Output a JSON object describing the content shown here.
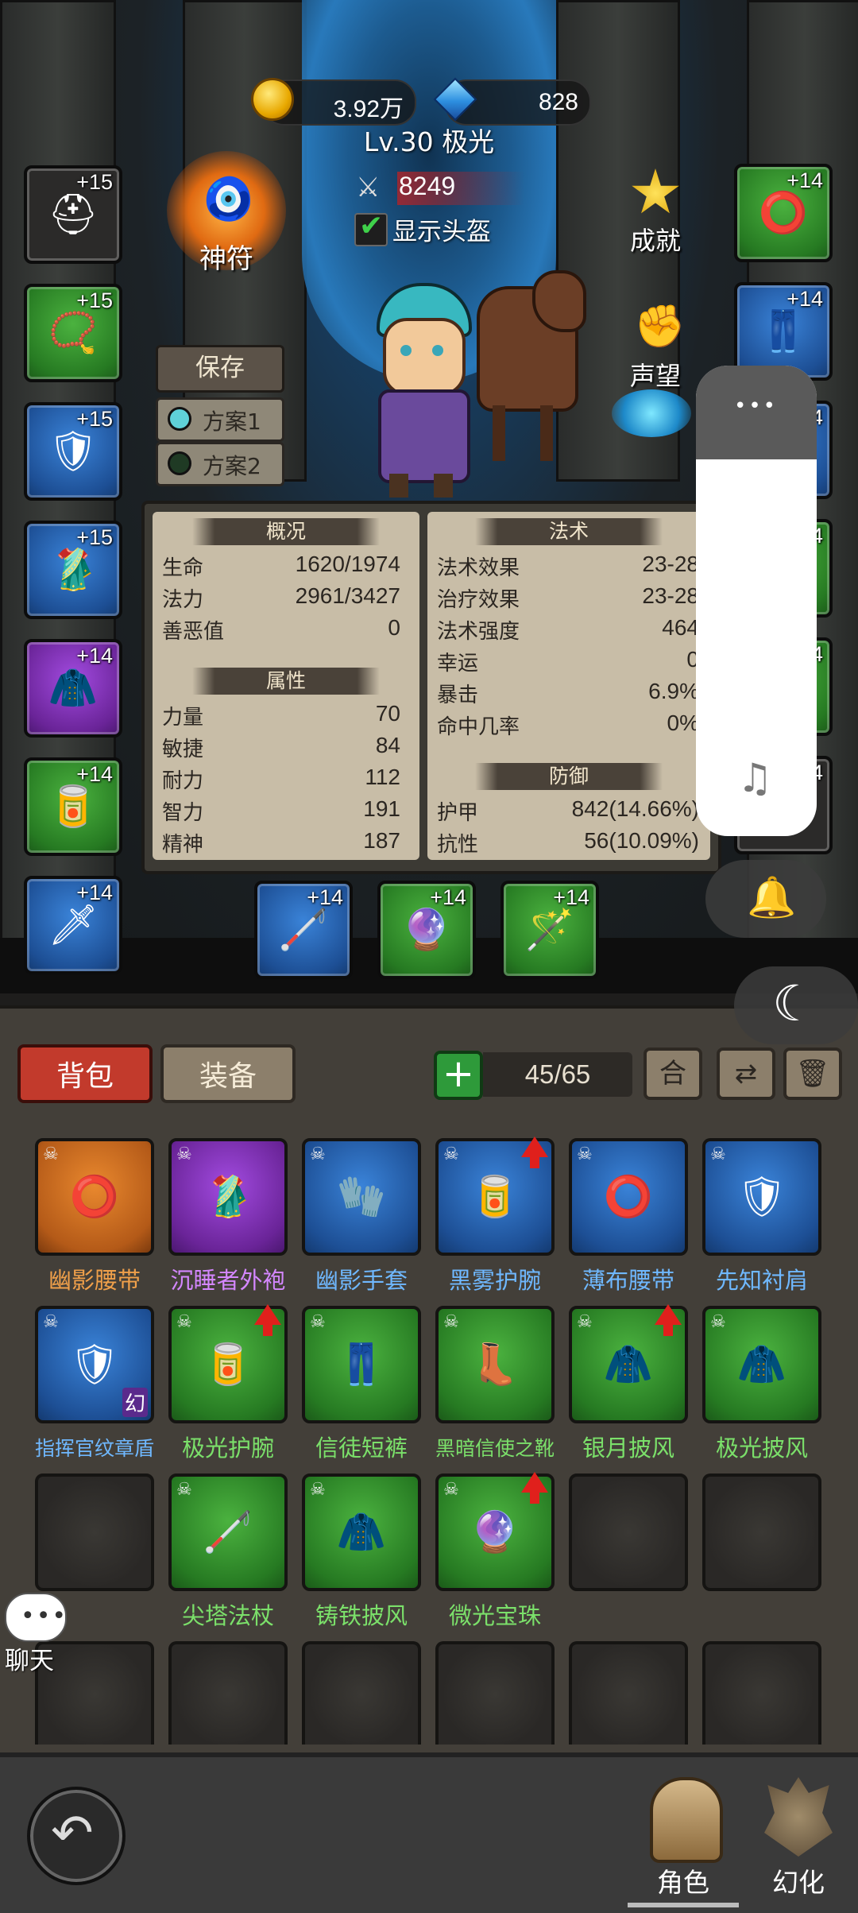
{
  "currency": {
    "gold": "3.92万",
    "gems": "828"
  },
  "hero": {
    "level_name": "Lv.30 极光",
    "power": "8249",
    "show_helmet_label": "显示头盔"
  },
  "buttons": {
    "talisman": "神符",
    "achievement": "成就",
    "reputation": "声望",
    "save": "保存",
    "plan1": "方案1",
    "plan2": "方案2"
  },
  "left_slots": [
    {
      "plus": "+15",
      "quality": "gray",
      "icon": "helmet-icon"
    },
    {
      "plus": "+15",
      "quality": "green",
      "icon": "necklace-icon"
    },
    {
      "plus": "+15",
      "quality": "blue",
      "icon": "shoulder-icon"
    },
    {
      "plus": "+15",
      "quality": "blue",
      "icon": "robe-icon"
    },
    {
      "plus": "+14",
      "quality": "purple",
      "icon": "cloak-icon"
    },
    {
      "plus": "+14",
      "quality": "green",
      "icon": "bracer-icon"
    },
    {
      "plus": "+14",
      "quality": "blue",
      "icon": "dagger-icon"
    }
  ],
  "right_slots": [
    {
      "plus": "+14",
      "quality": "green",
      "icon": "belt-icon"
    },
    {
      "plus": "+14",
      "quality": "blue",
      "icon": "legs-icon"
    },
    {
      "plus": "4",
      "quality": "blue"
    },
    {
      "plus": "4",
      "quality": "green"
    },
    {
      "plus": "4",
      "quality": "green"
    },
    {
      "plus": "4",
      "quality": "gray"
    }
  ],
  "bottom_slots": [
    {
      "plus": "+14",
      "quality": "blue",
      "icon": "staff-icon"
    },
    {
      "plus": "+14",
      "quality": "green",
      "icon": "orb-icon"
    },
    {
      "plus": "+14",
      "quality": "green",
      "icon": "wand-icon"
    }
  ],
  "stats": {
    "overview_title": "概况",
    "overview": [
      {
        "k": "生命",
        "v": "1620/1974"
      },
      {
        "k": "法力",
        "v": "2961/3427"
      },
      {
        "k": "善恶值",
        "v": "0"
      }
    ],
    "attr_title": "属性",
    "attrs": [
      {
        "k": "力量",
        "v": "70"
      },
      {
        "k": "敏捷",
        "v": "84"
      },
      {
        "k": "耐力",
        "v": "112"
      },
      {
        "k": "智力",
        "v": "191"
      },
      {
        "k": "精神",
        "v": "187"
      }
    ],
    "magic_title": "法术",
    "magic": [
      {
        "k": "法术效果",
        "v": "23-28"
      },
      {
        "k": "治疗效果",
        "v": "23-28"
      },
      {
        "k": "法术强度",
        "v": "464"
      },
      {
        "k": "幸运",
        "v": "0"
      },
      {
        "k": "暴击",
        "v": "6.9%"
      },
      {
        "k": "命中几率",
        "v": "0%"
      }
    ],
    "defense_title": "防御",
    "defense": [
      {
        "k": "护甲",
        "v": "842(14.66%)"
      },
      {
        "k": "抗性",
        "v": "56(10.09%)"
      }
    ]
  },
  "bag": {
    "tab_bag": "背包",
    "tab_equip": "装备",
    "add": "+",
    "capacity": "45/65",
    "merge": "合",
    "items": [
      {
        "name": "幽影腰带",
        "quality": "orange",
        "icon": "belt-icon"
      },
      {
        "name": "沉睡者外袍",
        "quality": "purple",
        "icon": "robe-icon"
      },
      {
        "name": "幽影手套",
        "quality": "blue",
        "icon": "glove-icon"
      },
      {
        "name": "黑雾护腕",
        "quality": "blue",
        "icon": "bracer-icon",
        "up": true
      },
      {
        "name": "薄布腰带",
        "quality": "blue",
        "icon": "belt-icon"
      },
      {
        "name": "先知衬肩",
        "quality": "blue",
        "icon": "shoulder-icon"
      },
      {
        "name": "指挥官纹章盾",
        "quality": "blue",
        "icon": "shield-icon",
        "badge": "幻"
      },
      {
        "name": "极光护腕",
        "quality": "green",
        "icon": "bracer-icon",
        "up": true
      },
      {
        "name": "信徒短裤",
        "quality": "green",
        "icon": "legs-icon"
      },
      {
        "name": "黑暗信使之靴",
        "quality": "green",
        "icon": "boots-icon"
      },
      {
        "name": "银月披风",
        "quality": "green",
        "icon": "cloak-icon",
        "up": true
      },
      {
        "name": "极光披风",
        "quality": "green",
        "icon": "cloak-icon"
      },
      {
        "name": "",
        "quality": "empty"
      },
      {
        "name": "尖塔法杖",
        "quality": "green",
        "icon": "staff-icon"
      },
      {
        "name": "铸铁披风",
        "quality": "green",
        "icon": "cloak-icon"
      },
      {
        "name": "微光宝珠",
        "quality": "green",
        "icon": "orb-icon",
        "up": true
      },
      {
        "name": "",
        "quality": "empty"
      },
      {
        "name": "",
        "quality": "empty"
      }
    ]
  },
  "chat": {
    "label": "聊天"
  },
  "nav": {
    "role": "角色",
    "transform": "幻化"
  }
}
